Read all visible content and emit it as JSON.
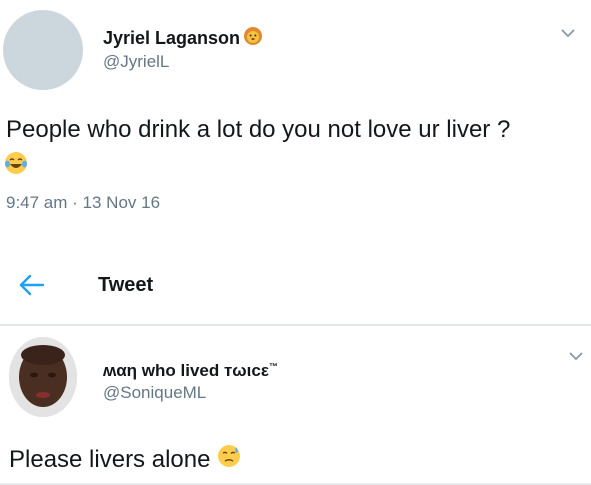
{
  "tweet": {
    "display_name": "Jyriel Laganson",
    "name_emoji": "lion-face-icon",
    "handle": "@JyrielL",
    "text": "People who drink a lot do you not love ur liver ?",
    "text_emoji": "tears-of-joy-icon",
    "timestamp": "9:47 am · 13 Nov 16"
  },
  "header": {
    "title": "Tweet",
    "back_icon": "back-arrow-icon"
  },
  "reply": {
    "display_name": "ʍαη who lived тωιcε",
    "display_name_suffix": "™",
    "handle": "@SoniqueML",
    "text": "Please livers alone",
    "text_emoji": "downcast-sweat-icon"
  },
  "colors": {
    "text_primary": "#14171a",
    "text_secondary": "#657786",
    "accent": "#1da1f2",
    "divider": "#e1e8ed"
  }
}
